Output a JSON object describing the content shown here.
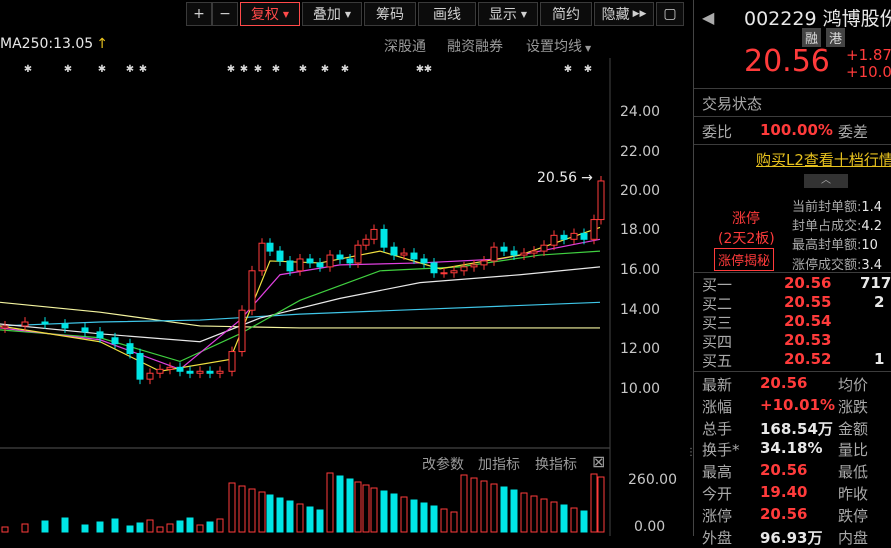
{
  "toolbar": {
    "plus": "+",
    "minus": "−",
    "fuquan": "复权",
    "diejia": "叠加",
    "chouma": "筹码",
    "huaxian": "画线",
    "xianshi": "显示",
    "jianyue": "简约",
    "yincang": "隐藏",
    "play": "▶▶",
    "window": "▢"
  },
  "ma_label": "MA250:13.05",
  "ma_arrow": "↑",
  "links": {
    "shengutong": "深股通",
    "rongzi": "融资融券",
    "shezhi": "设置均线"
  },
  "price_marker": "20.56",
  "y_ticks": [
    "24.00",
    "22.00",
    "20.00",
    "18.00",
    "16.00",
    "14.00",
    "12.00",
    "10.00"
  ],
  "vol_ticks": [
    "260.00",
    "0.00"
  ],
  "vol_links": {
    "gaicanshu": "改参数",
    "jiazhibiao": "加指标",
    "huanzhibiao": "换指标",
    "close": "⊠"
  },
  "stock": {
    "code": "002229",
    "name": "鸿博股份",
    "tag_rong": "融",
    "tag_gang": "港",
    "price": "20.56",
    "change": "+1.87",
    "change_pct": "+10.0"
  },
  "trade_status": "交易状态",
  "weibi": {
    "label": "委比",
    "value": "100.00%",
    "label2": "委差"
  },
  "l2_link": "购买L2查看十档行情",
  "limit": {
    "title": "涨停",
    "sub": "(2天2板)",
    "btn": "涨停揭秘",
    "stats": [
      {
        "label": "当前封单额:",
        "value": "1.4"
      },
      {
        "label": "封单占成交:",
        "value": "4.2"
      },
      {
        "label": "最高封单额:",
        "value": "10"
      },
      {
        "label": "涨停成交额:",
        "value": "3.4"
      }
    ]
  },
  "bids": [
    {
      "label": "买一",
      "price": "20.56",
      "vol": "717"
    },
    {
      "label": "买二",
      "price": "20.55",
      "vol": "2"
    },
    {
      "label": "买三",
      "price": "20.54",
      "vol": ""
    },
    {
      "label": "买四",
      "price": "20.53",
      "vol": ""
    },
    {
      "label": "买五",
      "price": "20.52",
      "vol": "1"
    }
  ],
  "quote": [
    {
      "l1": "最新",
      "v1": "20.56",
      "l2": "均价"
    },
    {
      "l1": "涨幅",
      "v1": "+10.01%",
      "l2": "涨跌"
    },
    {
      "l1": "总手",
      "v1": "168.54万",
      "l2": "金额"
    },
    {
      "l1": "换手*",
      "v1": "34.18%",
      "l2": "量比"
    },
    {
      "l1": "最高",
      "v1": "20.56",
      "l2": "最低"
    },
    {
      "l1": "今开",
      "v1": "19.40",
      "l2": "昨收"
    },
    {
      "l1": "涨停",
      "v1": "20.56",
      "l2": "跌停"
    },
    {
      "l1": "外盘",
      "v1": "96.93万",
      "l2": "内盘"
    }
  ],
  "colors": {
    "up": "#ff3b3b",
    "down": "#00e5e5",
    "bg": "#000000",
    "accent": "#ff4a4a"
  }
}
